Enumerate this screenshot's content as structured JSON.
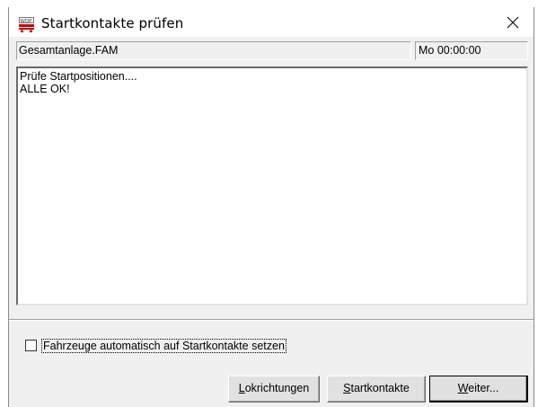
{
  "window": {
    "title": "Startkontakte prüfen",
    "app_icon": "wdp-app-icon",
    "close_icon": "close-icon"
  },
  "status": {
    "filename": "Gesamtanlage.FAM",
    "clock": "Mo 00:00:00"
  },
  "log": {
    "lines": [
      "Prüfe Startpositionen....",
      "ALLE OK!"
    ]
  },
  "options": {
    "auto_place_label": "Fahrzeuge automatisch auf Startkontakte setzen",
    "auto_place_checked": false
  },
  "buttons": {
    "lokrichtungen": {
      "mnemonic": "L",
      "rest": "okrichtungen"
    },
    "startkontakte": {
      "mnemonic": "S",
      "rest": "tartkontakte"
    },
    "weiter": {
      "mnemonic": "W",
      "rest": "eiter..."
    }
  },
  "colors": {
    "dialog_bg": "#f0f0f0",
    "button_bg": "#e1e1e1",
    "icon_red": "#cc0000"
  }
}
